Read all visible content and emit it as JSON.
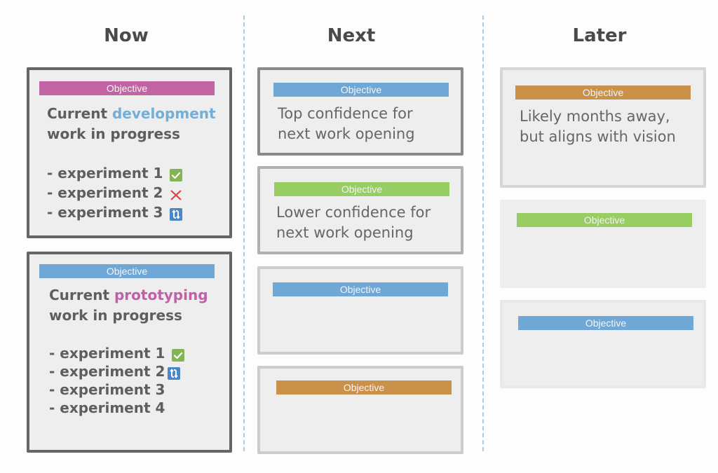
{
  "colors": {
    "magenta": "#c264a4",
    "blue": "#6fa8d6",
    "green": "#98cd63",
    "orange": "#c9914a",
    "check_green": "#83b455",
    "cross_red": "#d9434b",
    "refresh_blue": "#4a86c8",
    "divider": "#a8cbe6"
  },
  "columns": [
    {
      "title": "Now",
      "cards": [
        {
          "objective": "Objective",
          "objective_color": "magenta",
          "title_prefix": "Current ",
          "title_highlight": "development",
          "highlight_color": "#72aed6",
          "title_line2": "work in progress",
          "experiments": [
            {
              "label": "- experiment 1",
              "status": "check-icon"
            },
            {
              "label": "- experiment 2",
              "status": "cross-icon"
            },
            {
              "label": "- experiment 3",
              "status": "refresh-icon"
            }
          ]
        },
        {
          "objective": "Objective",
          "objective_color": "blue",
          "title_prefix": "Current ",
          "title_highlight": "prototyping",
          "highlight_color": "#c35ea8",
          "title_line2": "work in progress",
          "experiments": [
            {
              "label": "- experiment 1",
              "status": "check-icon"
            },
            {
              "label": "- experiment 2",
              "status": "refresh-icon"
            },
            {
              "label": "- experiment 3",
              "status": ""
            },
            {
              "label": "- experiment 4",
              "status": ""
            }
          ]
        }
      ]
    },
    {
      "title": "Next",
      "cards": [
        {
          "objective": "Objective",
          "objective_color": "blue",
          "text_line1": "Top confidence for",
          "text_line2": "next work opening"
        },
        {
          "objective": "Objective",
          "objective_color": "green",
          "text_line1": "Lower confidence for",
          "text_line2": "next work opening"
        },
        {
          "objective": "Objective",
          "objective_color": "blue"
        },
        {
          "objective": "Objective",
          "objective_color": "orange"
        }
      ]
    },
    {
      "title": "Later",
      "cards": [
        {
          "objective": "Objective",
          "objective_color": "orange",
          "text_line1": "Likely months away,",
          "text_line2": "but aligns with vision"
        },
        {
          "objective": "Objective",
          "objective_color": "green"
        },
        {
          "objective": "Objective",
          "objective_color": "blue"
        }
      ]
    }
  ]
}
